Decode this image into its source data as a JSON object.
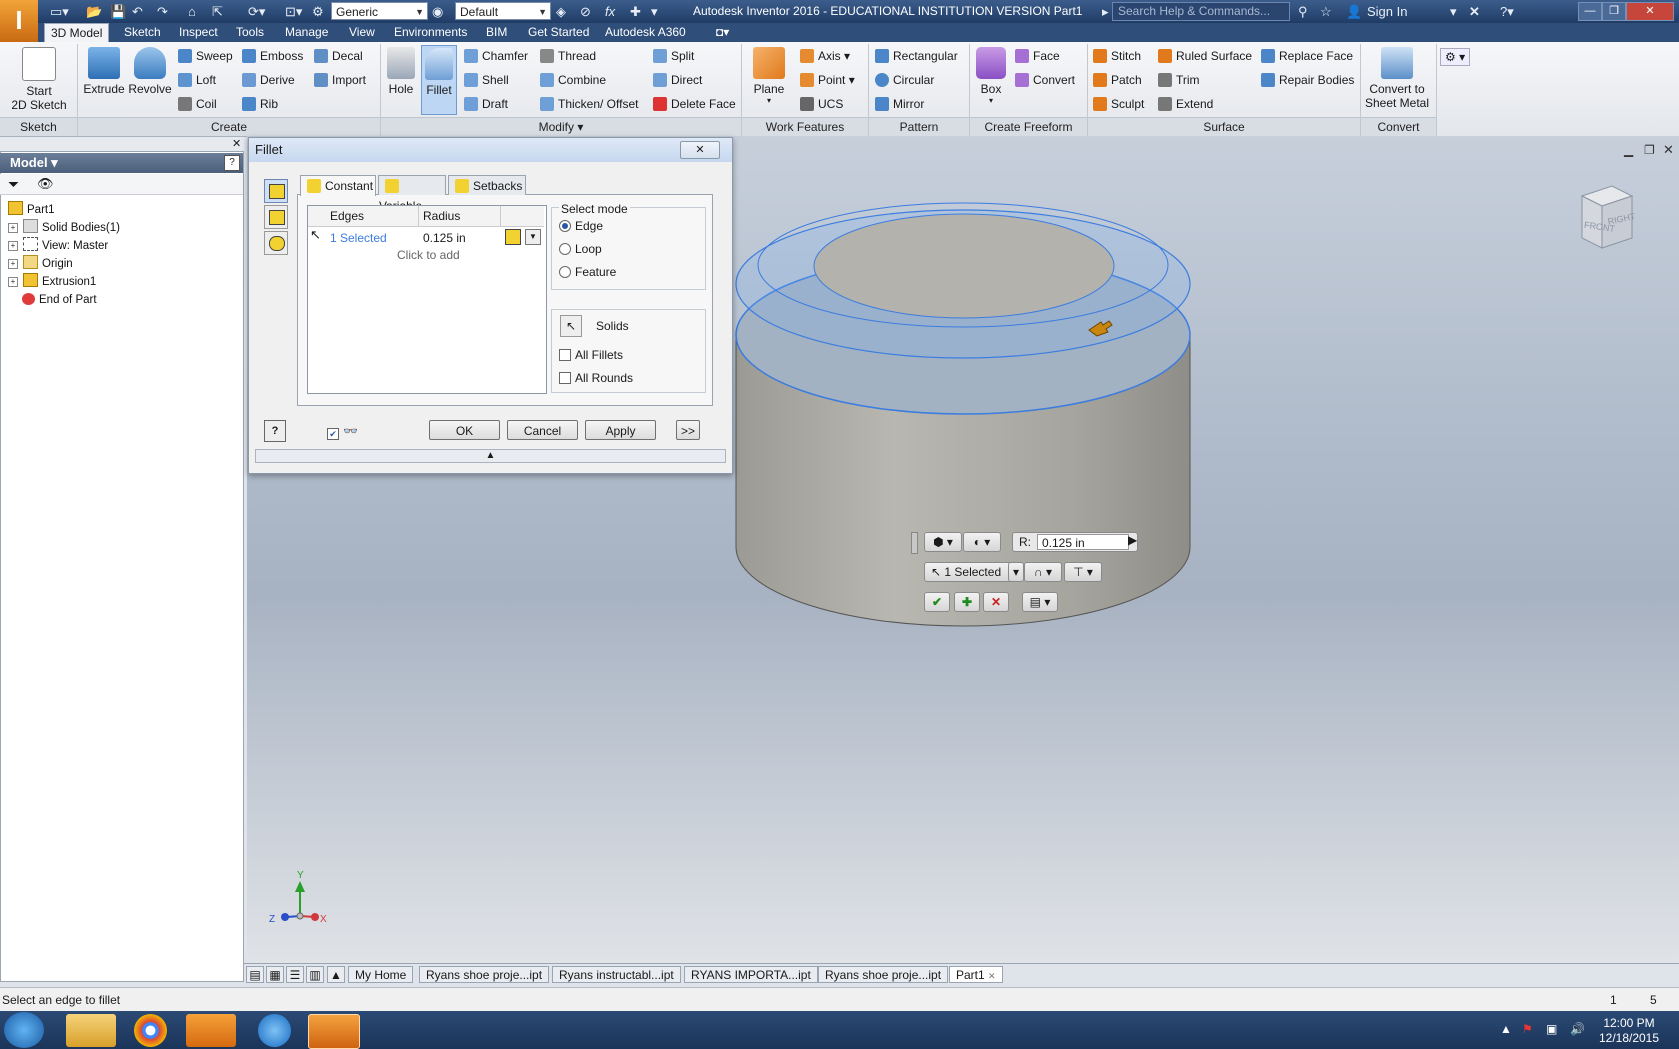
{
  "app": {
    "logo": "I",
    "window_title": "Autodesk Inventor 2016 - EDUCATIONAL INSTITUTION VERSION    Part1",
    "material_select": "Generic",
    "appearance_select": "Default",
    "search_placeholder": "Search Help & Commands...",
    "sign_in": "Sign In"
  },
  "ribbon_tabs": [
    "3D Model",
    "Sketch",
    "Inspect",
    "Tools",
    "Manage",
    "View",
    "Environments",
    "BIM",
    "Get Started",
    "Autodesk A360"
  ],
  "ribbon": {
    "sketch": {
      "start_sketch": "Start\n2D Sketch",
      "group": "Sketch"
    },
    "create": {
      "extrude": "Extrude",
      "revolve": "Revolve",
      "sweep": "Sweep",
      "loft": "Loft",
      "coil": "Coil",
      "emboss": "Emboss",
      "derive": "Derive",
      "rib": "Rib",
      "decal": "Decal",
      "import": "Import",
      "group": "Create"
    },
    "modify": {
      "hole": "Hole",
      "fillet": "Fillet",
      "chamfer": "Chamfer",
      "shell": "Shell",
      "draft": "Draft",
      "thread": "Thread",
      "combine": "Combine",
      "thicken": "Thicken/ Offset",
      "split": "Split",
      "direct": "Direct",
      "delete_face": "Delete Face",
      "group": "Modify"
    },
    "work": {
      "plane": "Plane",
      "axis": "Axis",
      "point": "Point",
      "ucs": "UCS",
      "group": "Work Features"
    },
    "pattern": {
      "rectangular": "Rectangular",
      "circular": "Circular",
      "mirror": "Mirror",
      "group": "Pattern"
    },
    "freeform": {
      "box": "Box",
      "face": "Face",
      "convert": "Convert",
      "group": "Create Freeform"
    },
    "surface": {
      "stitch": "Stitch",
      "patch": "Patch",
      "sculpt": "Sculpt",
      "ruled_surface": "Ruled Surface",
      "trim": "Trim",
      "extend": "Extend",
      "replace_face": "Replace Face",
      "repair_bodies": "Repair Bodies",
      "group": "Surface"
    },
    "convert": {
      "sheet_metal": "Convert to\nSheet Metal",
      "group": "Convert"
    }
  },
  "browser": {
    "header": "Model",
    "items": [
      "Part1",
      "Solid Bodies(1)",
      "View: Master",
      "Origin",
      "Extrusion1",
      "End of Part"
    ]
  },
  "dialog": {
    "title": "Fillet",
    "tabs": [
      "Constant",
      "Variable",
      "Setbacks"
    ],
    "columns": [
      "Edges",
      "Radius"
    ],
    "row": {
      "edges": "1 Selected",
      "radius": "0.125 in"
    },
    "click_to_add": "Click to add",
    "select_mode_label": "Select mode",
    "modes": [
      "Edge",
      "Loop",
      "Feature"
    ],
    "selected_mode": "Edge",
    "solids": "Solids",
    "all_fillets": "All Fillets",
    "all_rounds": "All Rounds",
    "ok": "OK",
    "cancel": "Cancel",
    "apply": "Apply",
    "more": ">>"
  },
  "minitoolbar": {
    "r_label": "R:",
    "radius": "0.125 in",
    "selected": "1 Selected"
  },
  "viewcube": {
    "front": "FRONT",
    "right": "RIGHT"
  },
  "axes": {
    "x": "X",
    "y": "Y",
    "z": "Z"
  },
  "doc_tabs": [
    "My Home",
    "Ryans shoe proje...ipt",
    "Ryans instructabl...ipt",
    "RYANS IMPORTA...ipt",
    "Ryans shoe proje...ipt",
    "Part1"
  ],
  "status": {
    "message": "Select an edge to fillet",
    "num1": "1",
    "num2": "5"
  },
  "clock": {
    "time": "12:00 PM",
    "date": "12/18/2015"
  }
}
